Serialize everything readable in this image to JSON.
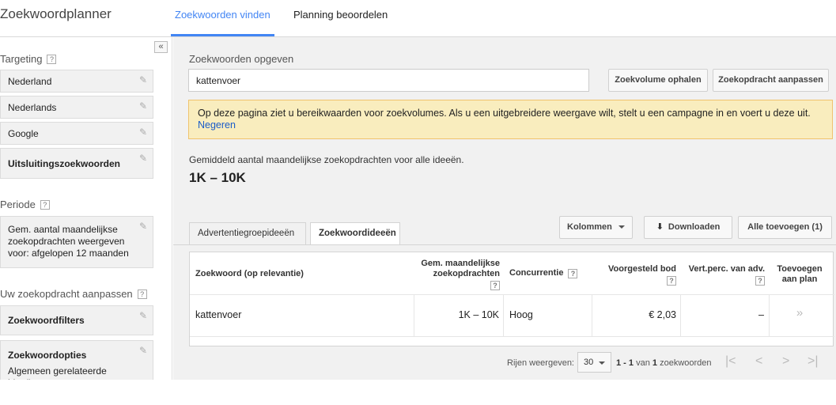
{
  "app_title": "Zoekwoordplanner",
  "tabs": [
    {
      "label": "Zoekwoorden vinden",
      "active": true
    },
    {
      "label": "Planning beoordelen",
      "active": false
    }
  ],
  "sidebar": {
    "collapse_glyph": "«",
    "targeting_label": "Targeting",
    "targeting_items": [
      "Nederland",
      "Nederlands",
      "Google"
    ],
    "exclusions_label": "Uitsluitingszoekwoorden",
    "period_label": "Periode",
    "period_text": "Gem. aantal maandelijkse zoekopdrachten weergeven voor: afgelopen 12 maanden",
    "customize_label": "Uw zoekopdracht aanpassen",
    "keyword_filters_label": "Zoekwoordfilters",
    "keyword_options_label": "Zoekwoordopties",
    "keyword_options_text": "Algemeen gerelateerde ideeën weergeven",
    "help_glyph": "?",
    "edit_glyph": "✎"
  },
  "main": {
    "enter_label": "Zoekwoorden opgeven",
    "keyword_value": "kattenvoer",
    "btn_get_volume": "Zoekvolume ophalen",
    "btn_modify": "Zoekopdracht aanpassen",
    "notice_text": "Op deze pagina ziet u bereikwaarden voor zoekvolumes. Als u een uitgebreidere weergave wilt, stelt u een campagne in en voert u deze uit.",
    "notice_link": "Negeren",
    "avg_label": "Gemiddeld aantal maandelijkse zoekopdrachten voor alle ideeën.",
    "avg_value": "1K – 10K",
    "subtabs": [
      "Advertentiegroepideeën",
      "Zoekwoordideeën"
    ],
    "btn_columns": "Kolommen",
    "btn_download": "Downloaden",
    "btn_add_all": "Alle toevoegen (1)",
    "download_glyph": "⬇"
  },
  "table": {
    "headers": {
      "keyword": "Zoekwoord (op relevantie)",
      "searches": "Gem. maandelijkse zoekopdrachten",
      "competition": "Concurrentie",
      "bid": "Voorgesteld bod",
      "impr_share": "Vert.perc. van adv.",
      "add": "Toevoegen aan plan"
    },
    "rows": [
      {
        "keyword": "kattenvoer",
        "searches": "1K – 10K",
        "competition": "Hoog",
        "bid": "€ 2,03",
        "impr_share": "–",
        "add": "»"
      }
    ]
  },
  "pager": {
    "rows_label": "Rijen weergeven:",
    "rows_value": "30",
    "range": "1 - 1",
    "of": "van",
    "total": "1",
    "unit": "zoekwoorden",
    "first": "|<",
    "prev": "<",
    "next": ">",
    "last": ">|"
  }
}
